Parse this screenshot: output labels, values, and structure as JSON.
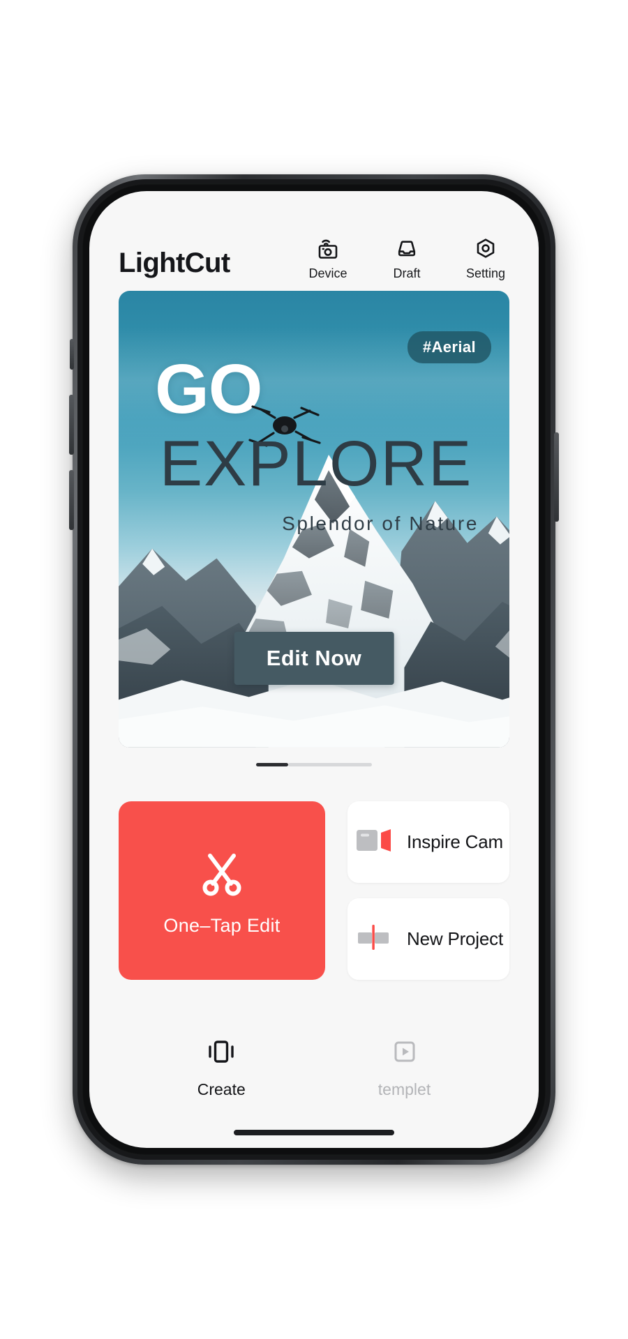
{
  "app": {
    "brand": "LightCut"
  },
  "header": {
    "actions": [
      {
        "label": "Device",
        "icon": "wifi-camera-icon"
      },
      {
        "label": "Draft",
        "icon": "inbox-tray-icon"
      },
      {
        "label": "Setting",
        "icon": "gear-nut-icon"
      }
    ]
  },
  "hero": {
    "badge": "#Aerial",
    "title_go": "GO",
    "title_explore": "EXPLORE",
    "subtitle": "Splendor of Nature",
    "cta": "Edit Now",
    "colors": {
      "sky_top": "#2a85a4",
      "sky_mid": "#68b4c8",
      "badge_bg": "#1f5463",
      "cta_bg": "#455a63"
    }
  },
  "pager": {
    "active_index": 0,
    "count": 2
  },
  "actions": {
    "primary": {
      "label": "One–Tap Edit",
      "icon": "scissors-icon",
      "color": "#f8504b"
    },
    "secondary": [
      {
        "label": "Inspire Cam",
        "icon": "camera-icon"
      },
      {
        "label": "New Project",
        "icon": "timeline-clip-icon"
      }
    ]
  },
  "tabbar": {
    "tabs": [
      {
        "label": "Create",
        "icon": "carousel-icon",
        "active": true
      },
      {
        "label": "templet",
        "icon": "play-square-icon",
        "active": false
      }
    ]
  }
}
